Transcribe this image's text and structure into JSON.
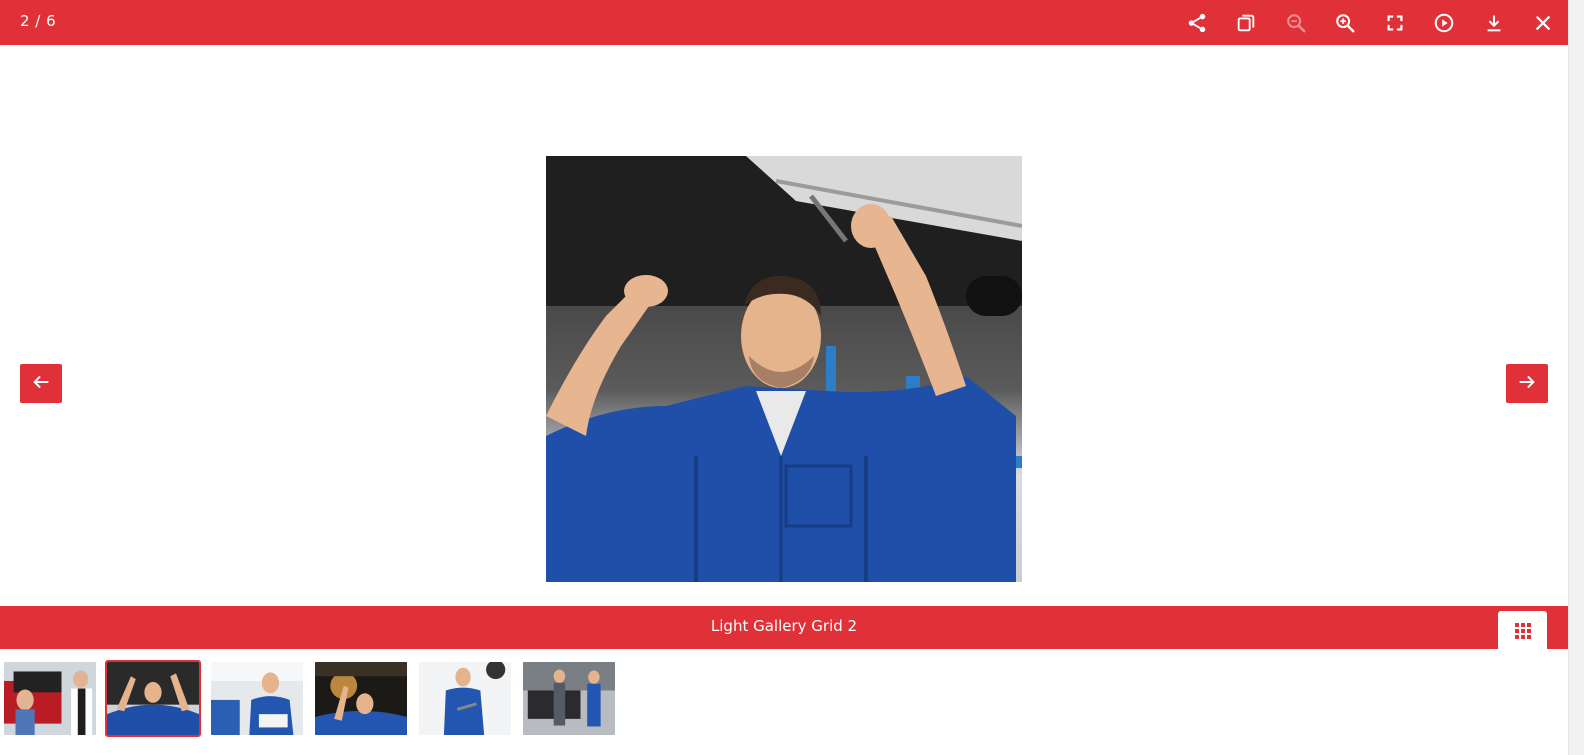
{
  "header": {
    "counter": "2 / 6"
  },
  "toolbar": {
    "items": [
      {
        "name": "share",
        "icon": "share-icon"
      },
      {
        "name": "copy",
        "icon": "copy-icon"
      },
      {
        "name": "zoom-out",
        "icon": "zoom-out-icon",
        "disabled": true
      },
      {
        "name": "zoom-in",
        "icon": "zoom-in-icon"
      },
      {
        "name": "fullscreen",
        "icon": "fullscreen-icon"
      },
      {
        "name": "autoplay",
        "icon": "play-icon"
      },
      {
        "name": "download",
        "icon": "download-icon"
      },
      {
        "name": "close",
        "icon": "close-icon"
      }
    ]
  },
  "navigation": {
    "prev_icon": "arrow-left-icon",
    "next_icon": "arrow-right-icon"
  },
  "caption": {
    "text": "Light Gallery Grid 2"
  },
  "thumbnails": {
    "active_index": 1,
    "count": 6
  },
  "colors": {
    "accent": "#e03139",
    "background": "#ffffff",
    "icon": "#ffffff"
  }
}
